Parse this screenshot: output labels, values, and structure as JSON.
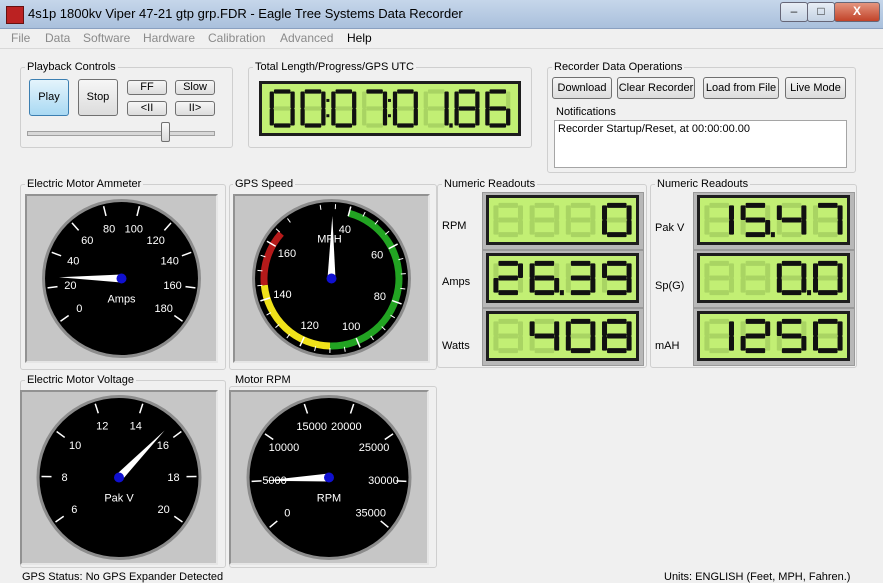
{
  "window": {
    "title": "4s1p 1800kv Viper 47-21 gtp grp.FDR - Eagle Tree Systems Data Recorder",
    "min_label": "–",
    "max_label": "□",
    "close_label": "X"
  },
  "menu": [
    "File",
    "Data",
    "Software",
    "Hardware",
    "Calibration",
    "Advanced",
    "Help"
  ],
  "playback": {
    "title": "Playback Controls",
    "play": "Play",
    "stop": "Stop",
    "ff": "FF",
    "slow": "Slow",
    "step_back": "<II",
    "step_fwd": "II>",
    "position": 0.75
  },
  "progress": {
    "title": "Total Length/Progress/GPS UTC",
    "value": "00:07:01.86"
  },
  "recorder_ops": {
    "title": "Recorder Data Operations",
    "download": "Download",
    "clear": "Clear Recorder",
    "load": "Load from File",
    "live": "Live Mode"
  },
  "notifications": {
    "title": "Notifications",
    "message": "Recorder Startup/Reset, at 00:00:00.00"
  },
  "ammeter": {
    "title": "Electric Motor Ammeter",
    "unit": "Amps",
    "ticks": [
      "0",
      "20",
      "40",
      "60",
      "80",
      "100",
      "120",
      "140",
      "160",
      "180"
    ],
    "value": 26
  },
  "gps": {
    "title": "GPS Speed",
    "unit": "MPH",
    "ticks": [
      "160",
      "40",
      "60",
      "140",
      "80",
      "120",
      "100"
    ],
    "value": 34
  },
  "voltage": {
    "title": "Electric Motor Voltage",
    "unit": "Pak V",
    "ticks": [
      "6",
      "8",
      "10",
      "12",
      "14",
      "16",
      "18",
      "20"
    ],
    "value": 15.47
  },
  "rpm": {
    "title": "Motor RPM",
    "unit": "RPM",
    "ticks": [
      "0",
      "5000",
      "10000",
      "15000",
      "20000",
      "25000",
      "30000",
      "35000"
    ],
    "value": 5000
  },
  "readouts_left": {
    "title": "Numeric Readouts",
    "rows": [
      {
        "label": "RPM",
        "value": "0"
      },
      {
        "label": "Amps",
        "value": "26.39"
      },
      {
        "label": "Watts",
        "value": "408"
      }
    ]
  },
  "readouts_right": {
    "title": "Numeric Readouts",
    "rows": [
      {
        "label": "Pak V",
        "value": "15.47"
      },
      {
        "label": "Sp(G)",
        "value": "0.0"
      },
      {
        "label": "mAH",
        "value": "1250"
      }
    ]
  },
  "status": {
    "gps": "GPS Status:  No GPS Expander Detected",
    "units": "Units: ENGLISH (Feet, MPH, Fahren.)"
  },
  "colors": {
    "lcd_bg": "#c2ef74",
    "lcd_digit": "#111111",
    "lcd_ghost": "#a9d463",
    "gauge_face": "#000000",
    "needle": "#ffffff",
    "hub": "#1010d0",
    "band_green": "#22a322",
    "band_yellow": "#f0e21a",
    "band_red": "#b51a1a"
  }
}
